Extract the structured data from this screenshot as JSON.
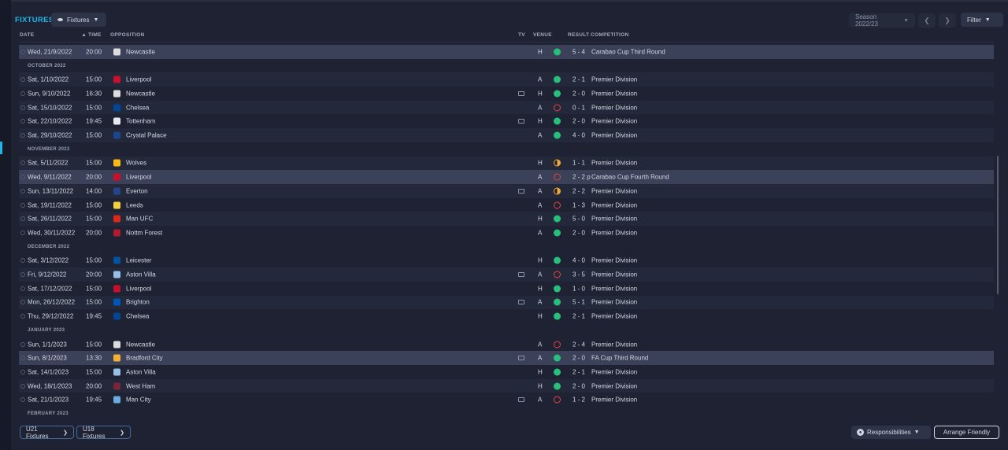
{
  "header": {
    "title": "FIXTURES",
    "view_selector": "Fixtures",
    "season": "Season 2022/23",
    "filter": "Filter"
  },
  "columns": {
    "date": "DATE",
    "time": "TIME",
    "opposition": "OPPOSITION",
    "tv": "TV",
    "venue": "VENUE",
    "result": "RESULT",
    "competition": "COMPETITION"
  },
  "rows": [
    {
      "kind": "match",
      "date": "Wed, 21/9/2022",
      "time": "20:00",
      "opp": "Newcastle",
      "crest": "#dcdcdc",
      "tv": false,
      "venue": "H",
      "res": "w",
      "score": "5 - 4",
      "comp": "Carabao Cup Third Round",
      "highlight": true
    },
    {
      "kind": "month",
      "label": "OCTOBER 2022"
    },
    {
      "kind": "match",
      "date": "Sat, 1/10/2022",
      "time": "15:00",
      "opp": "Liverpool",
      "crest": "#c8102e",
      "tv": false,
      "venue": "A",
      "res": "w",
      "score": "2 - 1",
      "comp": "Premier Division"
    },
    {
      "kind": "match",
      "date": "Sun, 9/10/2022",
      "time": "16:30",
      "opp": "Newcastle",
      "crest": "#dcdcdc",
      "tv": true,
      "venue": "H",
      "res": "w",
      "score": "2 - 0",
      "comp": "Premier Division"
    },
    {
      "kind": "match",
      "date": "Sat, 15/10/2022",
      "time": "15:00",
      "opp": "Chelsea",
      "crest": "#034694",
      "tv": false,
      "venue": "A",
      "res": "l",
      "score": "0 - 1",
      "comp": "Premier Division"
    },
    {
      "kind": "match",
      "date": "Sat, 22/10/2022",
      "time": "19:45",
      "opp": "Tottenham",
      "crest": "#e8e8f0",
      "tv": true,
      "venue": "H",
      "res": "w",
      "score": "2 - 0",
      "comp": "Premier Division"
    },
    {
      "kind": "match",
      "date": "Sat, 29/10/2022",
      "time": "15:00",
      "opp": "Crystal Palace",
      "crest": "#1b458f",
      "tv": false,
      "venue": "A",
      "res": "w",
      "score": "4 - 0",
      "comp": "Premier Division"
    },
    {
      "kind": "month",
      "label": "NOVEMBER 2022"
    },
    {
      "kind": "match",
      "date": "Sat, 5/11/2022",
      "time": "15:00",
      "opp": "Wolves",
      "crest": "#fdb913",
      "tv": false,
      "venue": "H",
      "res": "d",
      "score": "1 - 1",
      "comp": "Premier Division"
    },
    {
      "kind": "match",
      "date": "Wed, 9/11/2022",
      "time": "20:00",
      "opp": "Liverpool",
      "crest": "#c8102e",
      "tv": false,
      "venue": "A",
      "res": "l",
      "score": "2 - 2 p",
      "comp": "Carabao Cup Fourth Round",
      "highlight": true
    },
    {
      "kind": "match",
      "date": "Sun, 13/11/2022",
      "time": "14:00",
      "opp": "Everton",
      "crest": "#274488",
      "tv": true,
      "venue": "A",
      "res": "d",
      "score": "2 - 2",
      "comp": "Premier Division"
    },
    {
      "kind": "match",
      "date": "Sat, 19/11/2022",
      "time": "15:00",
      "opp": "Leeds",
      "crest": "#f4d03f",
      "tv": false,
      "venue": "A",
      "res": "l",
      "score": "1 - 3",
      "comp": "Premier Division"
    },
    {
      "kind": "match",
      "date": "Sat, 26/11/2022",
      "time": "15:00",
      "opp": "Man UFC",
      "crest": "#da291c",
      "tv": false,
      "venue": "H",
      "res": "w",
      "score": "5 - 0",
      "comp": "Premier Division"
    },
    {
      "kind": "match",
      "date": "Wed, 30/11/2022",
      "time": "20:00",
      "opp": "Nottm Forest",
      "crest": "#b01c2e",
      "tv": false,
      "venue": "A",
      "res": "w",
      "score": "2 - 0",
      "comp": "Premier Division"
    },
    {
      "kind": "month",
      "label": "DECEMBER 2022"
    },
    {
      "kind": "match",
      "date": "Sat, 3/12/2022",
      "time": "15:00",
      "opp": "Leicester",
      "crest": "#0053a0",
      "tv": false,
      "venue": "H",
      "res": "w",
      "score": "4 - 0",
      "comp": "Premier Division"
    },
    {
      "kind": "match",
      "date": "Fri, 9/12/2022",
      "time": "20:00",
      "opp": "Aston Villa",
      "crest": "#95bfe5",
      "tv": true,
      "venue": "A",
      "res": "l",
      "score": "3 - 5",
      "comp": "Premier Division"
    },
    {
      "kind": "match",
      "date": "Sat, 17/12/2022",
      "time": "15:00",
      "opp": "Liverpool",
      "crest": "#c8102e",
      "tv": false,
      "venue": "H",
      "res": "w",
      "score": "1 - 0",
      "comp": "Premier Division"
    },
    {
      "kind": "match",
      "date": "Mon, 26/12/2022",
      "time": "15:00",
      "opp": "Brighton",
      "crest": "#0057b8",
      "tv": true,
      "venue": "A",
      "res": "w",
      "score": "5 - 1",
      "comp": "Premier Division"
    },
    {
      "kind": "match",
      "date": "Thu, 29/12/2022",
      "time": "19:45",
      "opp": "Chelsea",
      "crest": "#034694",
      "tv": false,
      "venue": "H",
      "res": "w",
      "score": "2 - 1",
      "comp": "Premier Division"
    },
    {
      "kind": "month",
      "label": "JANUARY 2023"
    },
    {
      "kind": "match",
      "date": "Sun, 1/1/2023",
      "time": "15:00",
      "opp": "Newcastle",
      "crest": "#dcdcdc",
      "tv": false,
      "venue": "A",
      "res": "l",
      "score": "2 - 4",
      "comp": "Premier Division"
    },
    {
      "kind": "match",
      "date": "Sun, 8/1/2023",
      "time": "13:30",
      "opp": "Bradford City",
      "crest": "#f2b134",
      "tv": true,
      "venue": "A",
      "res": "w",
      "score": "2 - 0",
      "comp": "FA Cup Third Round",
      "highlight": true
    },
    {
      "kind": "match",
      "date": "Sat, 14/1/2023",
      "time": "15:00",
      "opp": "Aston Villa",
      "crest": "#95bfe5",
      "tv": false,
      "venue": "H",
      "res": "w",
      "score": "2 - 1",
      "comp": "Premier Division"
    },
    {
      "kind": "match",
      "date": "Wed, 18/1/2023",
      "time": "20:00",
      "opp": "West Ham",
      "crest": "#7a263a",
      "tv": false,
      "venue": "H",
      "res": "w",
      "score": "2 - 0",
      "comp": "Premier Division"
    },
    {
      "kind": "match",
      "date": "Sat, 21/1/2023",
      "time": "19:45",
      "opp": "Man City",
      "crest": "#6cabdd",
      "tv": true,
      "venue": "A",
      "res": "l",
      "score": "1 - 2",
      "comp": "Premier Division"
    },
    {
      "kind": "month",
      "label": "FEBRUARY 2023"
    }
  ],
  "footer": {
    "u21": "U21 Fixtures",
    "u18": "U18 Fixtures",
    "responsibilities": "Responsibilities",
    "arrange": "Arrange Friendly"
  },
  "colors": {
    "accent": "#1fb6e8",
    "win": "#27c07a",
    "loss": "#e0453f",
    "draw": "#f0a93a"
  }
}
